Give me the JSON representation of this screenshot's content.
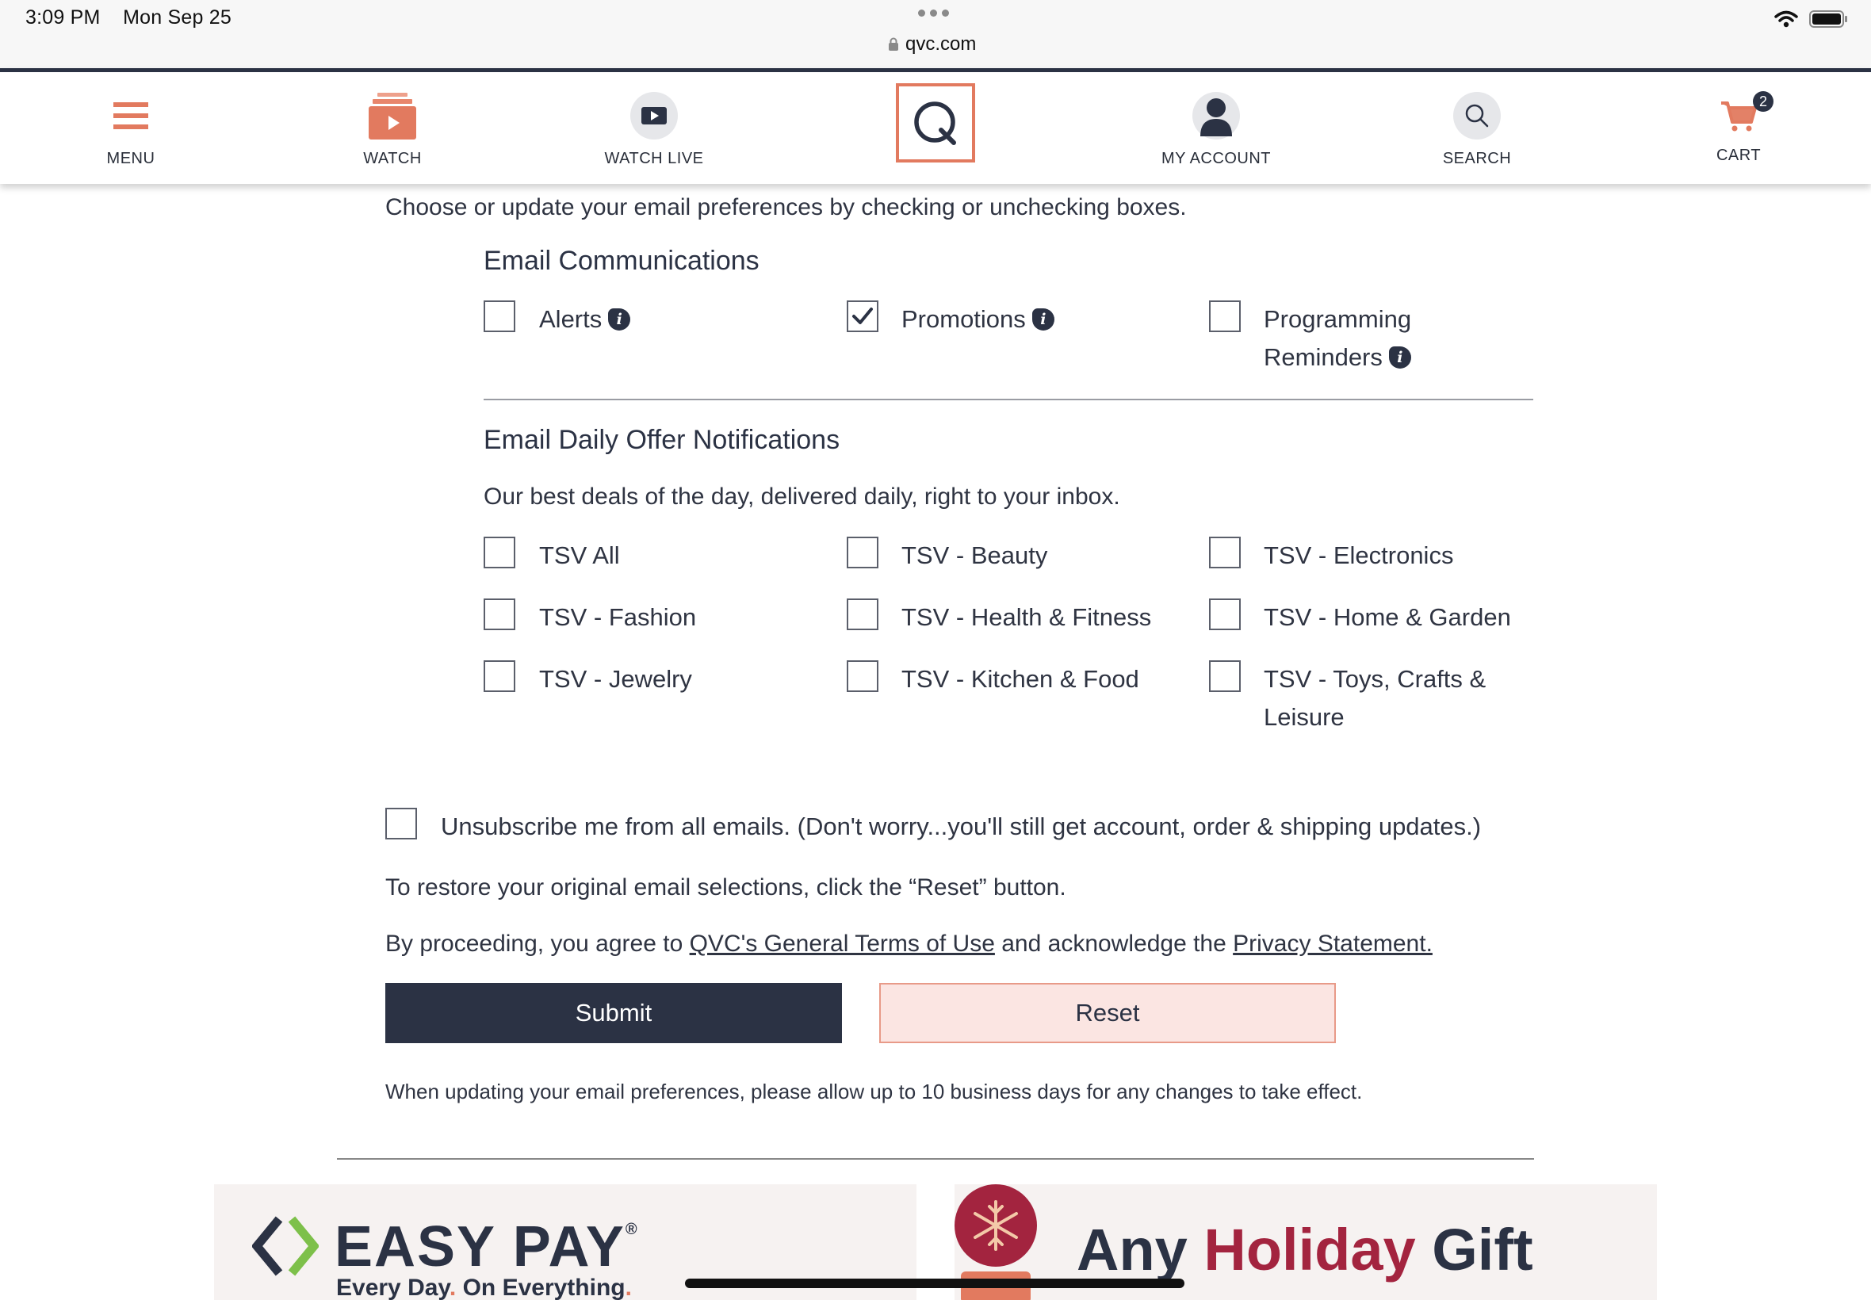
{
  "status_bar": {
    "time": "3:09 PM",
    "date": "Mon Sep 25",
    "url": "qvc.com"
  },
  "nav": {
    "menu": "MENU",
    "watch": "WATCH",
    "watch_live": "WATCH LIVE",
    "my_account": "MY ACCOUNT",
    "search": "SEARCH",
    "cart": "CART",
    "cart_count": "2"
  },
  "intro": "Choose or update your email preferences by checking or unchecking boxes.",
  "email_communications": {
    "title": "Email Communications",
    "options": [
      {
        "label": "Alerts",
        "checked": false
      },
      {
        "label": "Promotions",
        "checked": true
      },
      {
        "label_line1": "Programming",
        "label_line2": "Reminders",
        "checked": false
      }
    ]
  },
  "daily_offers": {
    "title": "Email Daily Offer Notifications",
    "description": "Our best deals of the day, delivered daily, right to your inbox.",
    "options": [
      {
        "label": "TSV All",
        "checked": false
      },
      {
        "label": "TSV - Beauty",
        "checked": false
      },
      {
        "label": "TSV - Electronics",
        "checked": false
      },
      {
        "label": "TSV - Fashion",
        "checked": false
      },
      {
        "label": "TSV - Health & Fitness",
        "checked": false
      },
      {
        "label": "TSV - Home & Garden",
        "checked": false
      },
      {
        "label": "TSV - Jewelry",
        "checked": false
      },
      {
        "label": "TSV - Kitchen & Food",
        "checked": false
      },
      {
        "label_line1": "TSV - Toys, Crafts &",
        "label_line2": "Leisure",
        "checked": false
      }
    ]
  },
  "unsubscribe": {
    "label": "Unsubscribe me from all emails. (Don't worry...you'll still get account, order & shipping updates.)",
    "checked": false
  },
  "restore_text": "To restore your original email selections, click the “Reset” button.",
  "agreement": {
    "prefix": "By proceeding, you agree to ",
    "terms_link": "QVC's General Terms of Use",
    "middle": " and acknowledge the ",
    "privacy_link": "Privacy Statement."
  },
  "buttons": {
    "submit": "Submit",
    "reset": "Reset"
  },
  "note": "When updating your email preferences, please allow up to 10 business days for any changes to take effect.",
  "banners": {
    "easy_pay_title": "EASY PAY",
    "easy_pay_reg": "®",
    "easy_pay_sub_1": "Every Day",
    "easy_pay_sub_2": "On Everything",
    "holiday_word1": "Any",
    "holiday_word2": "Holiday",
    "holiday_word3": "Gift"
  },
  "colors": {
    "navy": "#2b3244",
    "coral": "#e27a5f",
    "reset_bg": "#fbe5e2",
    "holiday_accent": "#a3243f",
    "easy_pay_green": "#7dc04a"
  }
}
